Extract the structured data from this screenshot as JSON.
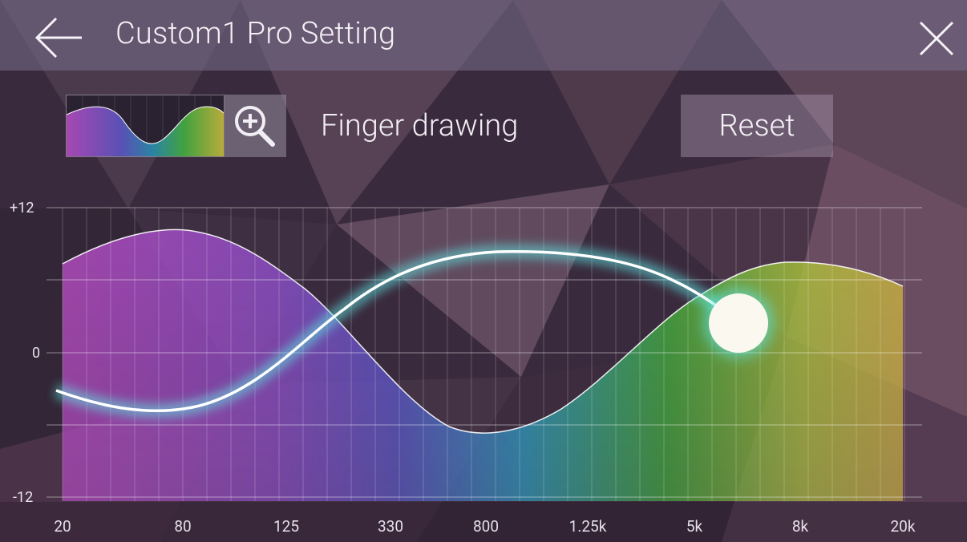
{
  "header": {
    "title": "Custom1 Pro Setting"
  },
  "toolbar": {
    "mode_label": "Finger drawing",
    "reset_label": "Reset"
  },
  "icons": {
    "back": "arrow-left-icon",
    "close": "close-icon",
    "zoom": "zoom-in-icon"
  },
  "graph": {
    "y_labels": [
      "+12",
      "0",
      "-12"
    ],
    "x_labels": [
      "20",
      "80",
      "125",
      "330",
      "800",
      "1.25k",
      "5k",
      "8k",
      "20k"
    ],
    "y_range": [
      -12,
      12
    ],
    "drawn_curve_color": "#ffffff",
    "glow_color": "#5fe3e0"
  },
  "colors": {
    "spectrum": [
      "#b44cc0",
      "#6a52c8",
      "#2ea0c8",
      "#3db23f",
      "#b8c23a",
      "#c9b040"
    ]
  }
}
